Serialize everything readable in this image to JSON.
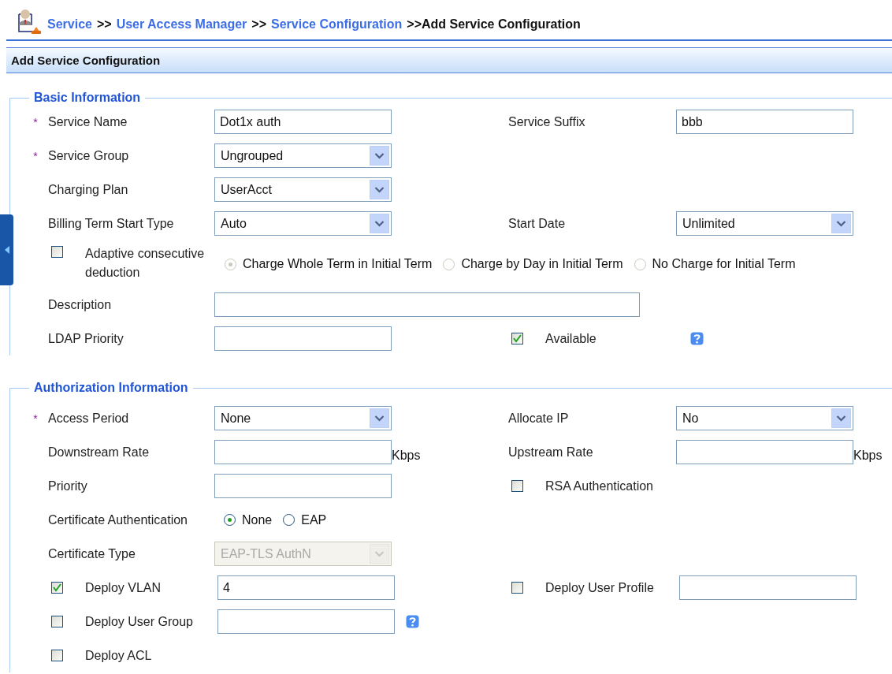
{
  "breadcrumb": {
    "links": [
      "Service",
      "User Access Manager",
      "Service Configuration"
    ],
    "separator": ">>",
    "current": "Add Service Configuration"
  },
  "panel_title": "Add Service Configuration",
  "sections": [
    {
      "legend": "Basic Information",
      "rows": [
        {
          "kind": "standard",
          "left": {
            "marker": "*",
            "label": "Service Name",
            "control": {
              "kind": "text",
              "value": "Dot1x auth"
            }
          },
          "right": {
            "label": "Service Suffix",
            "control": {
              "kind": "text",
              "value": "bbb"
            }
          }
        },
        {
          "kind": "standard",
          "left": {
            "marker": "*",
            "label": "Service Group",
            "control": {
              "kind": "select",
              "value": "Ungrouped",
              "disabled": false
            }
          }
        },
        {
          "kind": "standard",
          "left": {
            "label": "Charging Plan",
            "control": {
              "kind": "select",
              "value": "UserAcct",
              "disabled": false
            }
          }
        },
        {
          "kind": "standard",
          "left": {
            "label": "Billing Term Start Type",
            "control": {
              "kind": "select",
              "value": "Auto",
              "disabled": false
            }
          },
          "right": {
            "label": "Start Date",
            "control": {
              "kind": "select",
              "value": "Unlimited",
              "disabled": false
            }
          }
        },
        {
          "kind": "spanning",
          "left": {
            "label": "Adaptive consecutive deduction",
            "checkbox": {
              "checked": false
            },
            "control": {
              "kind": "radios",
              "disabled": true,
              "options": [
                {
                  "label": "Charge Whole Term in Initial Term",
                  "selected": true
                },
                {
                  "label": "Charge by Day in Initial Term",
                  "selected": false
                },
                {
                  "label": "No Charge for Initial Term",
                  "selected": false
                }
              ]
            }
          }
        },
        {
          "kind": "spanning",
          "left": {
            "label": "Description",
            "control": {
              "kind": "text"
            }
          }
        },
        {
          "kind": "standard",
          "left": {
            "label": "LDAP Priority",
            "control": {
              "kind": "text"
            }
          },
          "right": {
            "label": "Available",
            "checkbox": {
              "checked": true
            },
            "help": true
          }
        }
      ]
    },
    {
      "legend": "Authorization Information",
      "rows": [
        {
          "kind": "standard",
          "left": {
            "marker": "*",
            "label": "Access Period",
            "control": {
              "kind": "select",
              "value": "None",
              "disabled": false
            }
          },
          "right": {
            "label": "Allocate IP",
            "control": {
              "kind": "select",
              "value": "No",
              "disabled": false
            }
          }
        },
        {
          "kind": "standard",
          "left": {
            "label": "Downstream Rate",
            "control": {
              "kind": "text"
            },
            "unit": "Kbps"
          },
          "right": {
            "label": "Upstream Rate",
            "control": {
              "kind": "text"
            },
            "unit": "Kbps"
          }
        },
        {
          "kind": "standard",
          "left": {
            "label": "Priority",
            "control": {
              "kind": "text"
            }
          },
          "right": {
            "label": "RSA Authentication",
            "checkbox": {
              "checked": false
            }
          }
        },
        {
          "kind": "standard",
          "left": {
            "label": "Certificate Authentication",
            "control": {
              "kind": "radios",
              "disabled": false,
              "options": [
                {
                  "label": "None",
                  "selected": true
                },
                {
                  "label": "EAP",
                  "selected": false
                }
              ]
            }
          }
        },
        {
          "kind": "standard",
          "left": {
            "label": "Certificate Type",
            "control": {
              "kind": "select",
              "value": "EAP-TLS AuthN",
              "disabled": true
            }
          }
        },
        {
          "kind": "standard",
          "left": {
            "label": "Deploy VLAN",
            "checkbox": {
              "checked": true
            },
            "control": {
              "kind": "text",
              "value": "4"
            }
          },
          "right": {
            "label": "Deploy User Profile",
            "checkbox": {
              "checked": false
            },
            "control": {
              "kind": "text"
            }
          }
        },
        {
          "kind": "standard",
          "left": {
            "label": "Deploy User Group",
            "checkbox": {
              "checked": false
            },
            "control": {
              "kind": "text"
            },
            "help": true
          }
        },
        {
          "kind": "standard",
          "left": {
            "label": "Deploy ACL",
            "checkbox": {
              "checked": false
            }
          }
        }
      ]
    }
  ]
}
